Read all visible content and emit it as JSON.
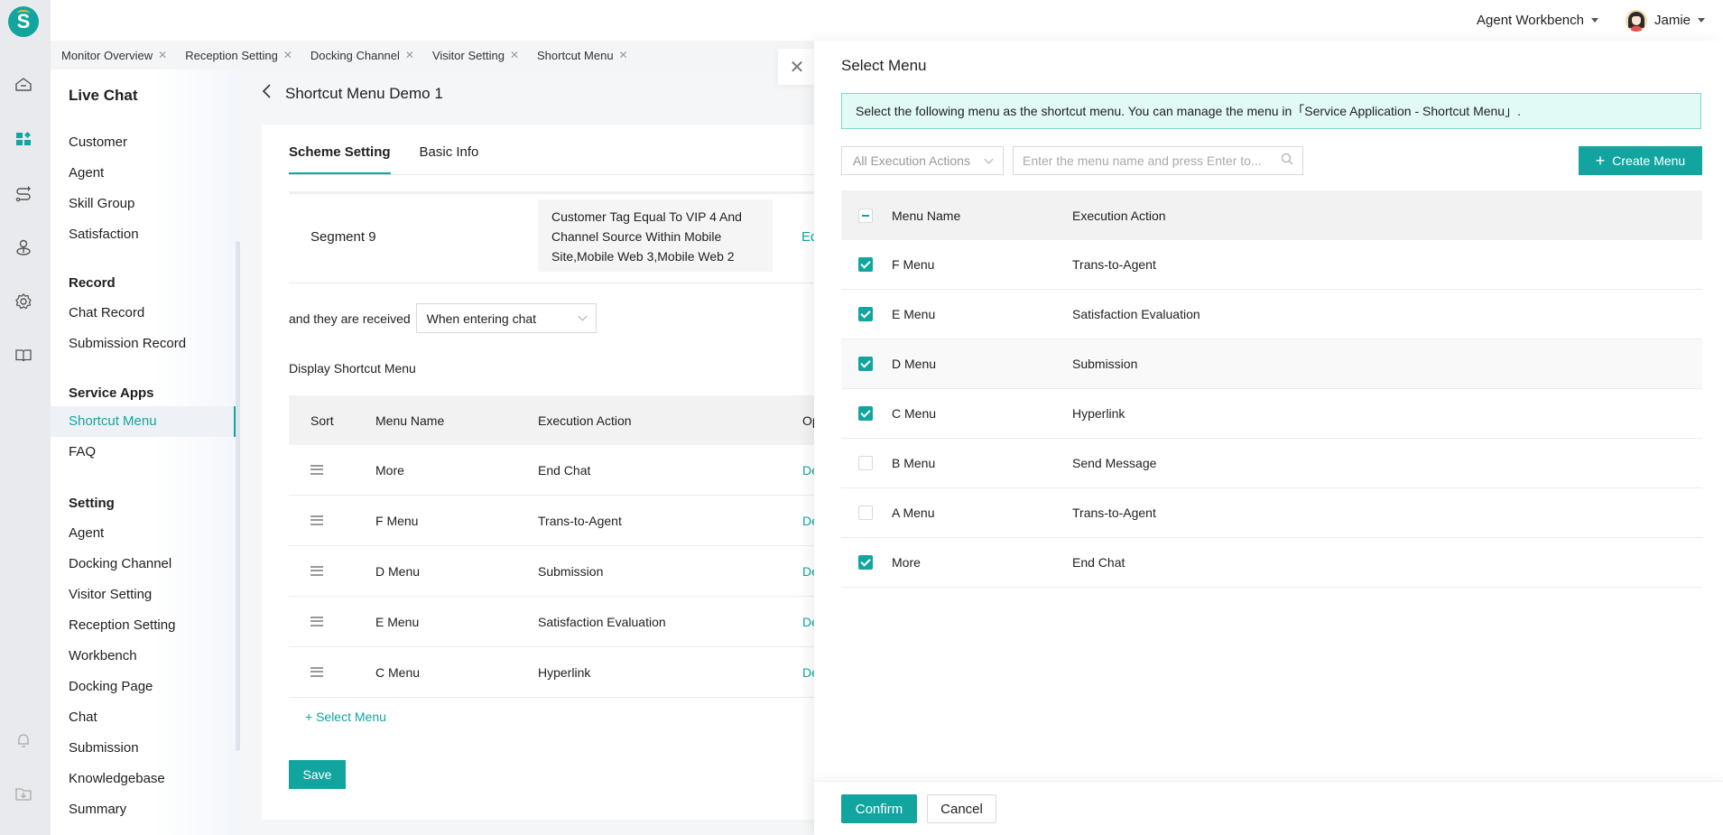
{
  "topbar": {
    "workbench_label": "Agent Workbench",
    "user_name": "Jamie"
  },
  "rail": {
    "logo_letter": "S",
    "icons": [
      "home-icon",
      "dashboard-icon",
      "routing-icon",
      "agent-icon",
      "settings-icon",
      "book-icon",
      "bell-icon",
      "download-folder-icon"
    ],
    "active_icon": "dashboard-icon"
  },
  "tabs": [
    {
      "label": "Monitor Overview"
    },
    {
      "label": "Reception Setting"
    },
    {
      "label": "Docking Channel"
    },
    {
      "label": "Visitor Setting"
    },
    {
      "label": "Shortcut Menu"
    }
  ],
  "sidebar": {
    "title": "Live Chat",
    "groups": [
      {
        "heading": "",
        "items": [
          "Customer",
          "Agent",
          "Skill Group",
          "Satisfaction"
        ]
      },
      {
        "heading": "Record",
        "items": [
          "Chat Record",
          "Submission Record"
        ]
      },
      {
        "heading": "Service Apps",
        "items": [
          "Shortcut Menu",
          "FAQ"
        ]
      },
      {
        "heading": "Setting",
        "items": [
          "Agent",
          "Docking Channel",
          "Visitor Setting",
          "Reception Setting",
          "Workbench",
          "Docking Page",
          "Chat",
          "Submission",
          "Knowledgebase",
          "Summary"
        ]
      }
    ],
    "active_item": "Shortcut Menu"
  },
  "main": {
    "page_title": "Shortcut Menu Demo 1",
    "tabs": [
      {
        "label": "Scheme Setting",
        "active": true
      },
      {
        "label": "Basic Info",
        "active": false
      }
    ],
    "segment": {
      "name": "Segment 9",
      "condition": "Customer Tag Equal To VIP 4 And Channel Source Within Mobile Site,Mobile Web 3,Mobile Web 2",
      "edit_label": "Ed"
    },
    "received_label": "and they are received",
    "received_value": "When entering chat",
    "display_title": "Display Shortcut Menu",
    "table": {
      "headers": {
        "sort": "Sort",
        "name": "Menu Name",
        "action": "Execution Action",
        "op": "Op"
      },
      "rows": [
        {
          "name": "More",
          "action": "End Chat",
          "op": "De"
        },
        {
          "name": "F Menu",
          "action": "Trans-to-Agent",
          "op": "De"
        },
        {
          "name": "D Menu",
          "action": "Submission",
          "op": "De"
        },
        {
          "name": "E Menu",
          "action": "Satisfaction Evaluation",
          "op": "De"
        },
        {
          "name": "C Menu",
          "action": "Hyperlink",
          "op": "De"
        }
      ]
    },
    "add_label": "+ Select Menu",
    "save_label": "Save"
  },
  "drawer": {
    "close_glyph": "✕",
    "title": "Select Menu",
    "alert": "Select the following menu as the shortcut menu. You can manage the menu in「Service Application - Shortcut Menu」.",
    "filter_value": "All Execution Actions",
    "search_placeholder": "Enter the menu name and press Enter to...",
    "create_label": "Create Menu",
    "headers": {
      "name": "Menu Name",
      "action": "Execution Action"
    },
    "header_checkbox": "indeterminate",
    "rows": [
      {
        "name": "F Menu",
        "action": "Trans-to-Agent",
        "checked": true
      },
      {
        "name": "E Menu",
        "action": "Satisfaction Evaluation",
        "checked": true
      },
      {
        "name": "D Menu",
        "action": "Submission",
        "checked": true
      },
      {
        "name": "C Menu",
        "action": "Hyperlink",
        "checked": true
      },
      {
        "name": "B Menu",
        "action": "Send Message",
        "checked": false
      },
      {
        "name": "A Menu",
        "action": "Trans-to-Agent",
        "checked": false
      },
      {
        "name": "More",
        "action": "End Chat",
        "checked": true
      }
    ],
    "confirm_label": "Confirm",
    "cancel_label": "Cancel"
  },
  "colors": {
    "accent": "#12a5a0",
    "alert_bg": "#e1faf5",
    "alert_border": "#7dd9cc"
  }
}
